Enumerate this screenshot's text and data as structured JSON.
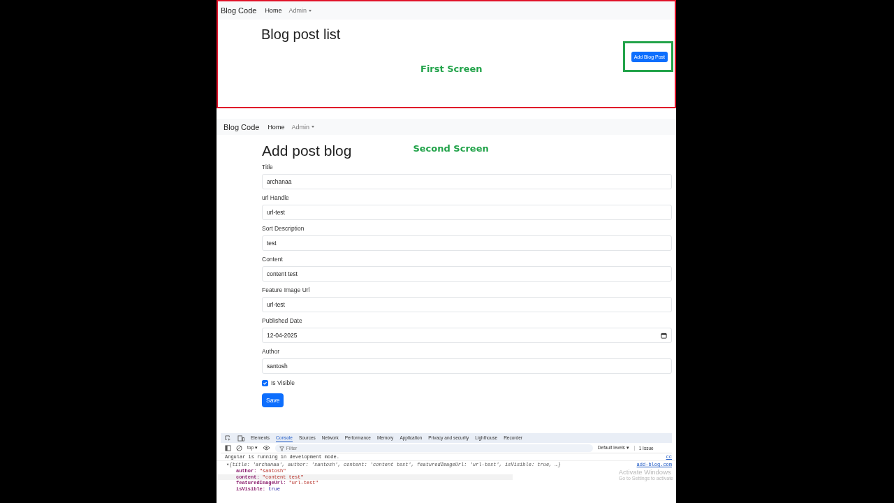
{
  "first_screen": {
    "navbar": {
      "brand": "Blog Code",
      "links": [
        {
          "label": "Home",
          "kind": "link"
        },
        {
          "label": "Admin",
          "kind": "dropdown"
        }
      ]
    },
    "heading": "Blog post list",
    "caption": "First Screen",
    "add_button": "Add Blog Post"
  },
  "second_screen": {
    "navbar": {
      "brand": "Blog Code",
      "links": [
        {
          "label": "Home",
          "kind": "link"
        },
        {
          "label": "Admin",
          "kind": "dropdown"
        }
      ]
    },
    "heading": "Add post blog",
    "caption": "Second Screen",
    "fields": [
      {
        "kind": "text",
        "label": "Title",
        "value": "archanaa"
      },
      {
        "kind": "text",
        "label": "url Handle",
        "value": "url-test"
      },
      {
        "kind": "text",
        "label": "Sort Description",
        "value": "test"
      },
      {
        "kind": "text",
        "label": "Content",
        "value": "content test"
      },
      {
        "kind": "text",
        "label": "Feature Image Url",
        "value": "url-test"
      },
      {
        "kind": "date",
        "label": "Published Date",
        "value": "12-04-2025"
      },
      {
        "kind": "text",
        "label": "Author",
        "value": "santosh"
      },
      {
        "kind": "checkbox",
        "label": "Is Visible",
        "checked": true
      }
    ],
    "save_button": "Save"
  },
  "devtools": {
    "tabs": [
      {
        "label": "Elements",
        "selected": false
      },
      {
        "label": "Console",
        "selected": true
      },
      {
        "label": "Sources",
        "selected": false
      },
      {
        "label": "Network",
        "selected": false
      },
      {
        "label": "Performance",
        "selected": false
      },
      {
        "label": "Memory",
        "selected": false
      },
      {
        "label": "Application",
        "selected": false
      },
      {
        "label": "Privacy and security",
        "selected": false
      },
      {
        "label": "Lighthouse",
        "selected": false
      },
      {
        "label": "Recorder",
        "selected": false
      }
    ],
    "context": "top ▾",
    "filter_placeholder": "Filter",
    "levels": "Default levels ▾",
    "issues": "1 Issue",
    "messages": [
      {
        "text": "Angular is running in development mode.",
        "source": "cc"
      },
      {
        "text": "▾{title: 'archanaa', author: 'santosh', content: 'content test', featuredImageUrl: 'url-test', isVisible: true, …}",
        "source": "add-blog.com"
      }
    ],
    "properties": [
      {
        "key": "author:",
        "value": "\"santosh\"",
        "kind": "string"
      },
      {
        "key": "content:",
        "value": "\"content test\"",
        "kind": "string"
      },
      {
        "key": "featuredImageUrl:",
        "value": "\"url-test\"",
        "kind": "string"
      },
      {
        "key": "isVisible:",
        "value": "true",
        "kind": "bool"
      }
    ]
  },
  "os_notice": {
    "title": "Activate Windows",
    "subtitle": "Go to Settings to activate"
  }
}
